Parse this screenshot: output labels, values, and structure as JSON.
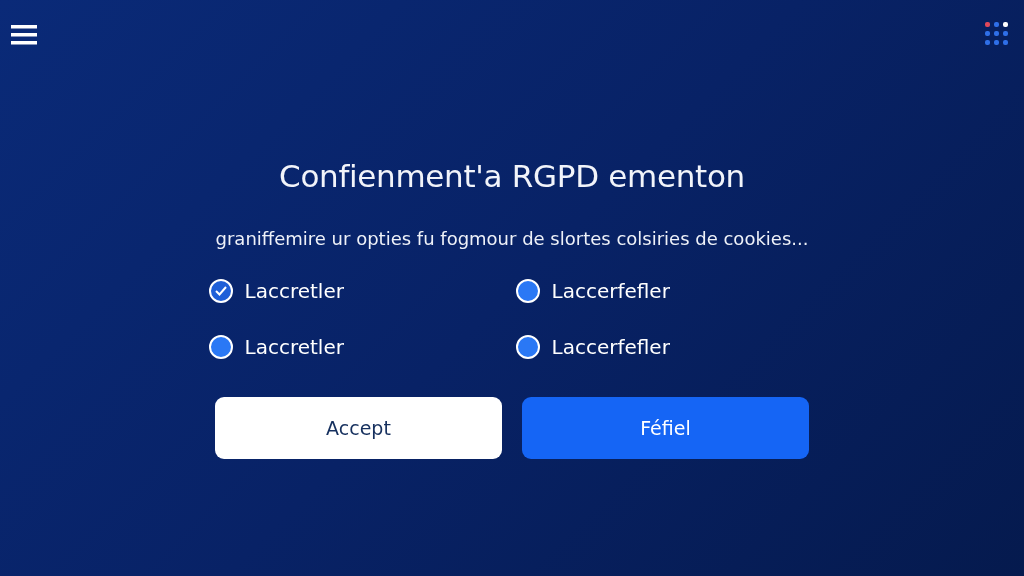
{
  "title": "Confienment'a RGPD ementon",
  "subtitle": "graniffemire ur opties fu fogmour de slortes colsiries de cookies...",
  "options": [
    {
      "label": "Laccretler",
      "checked": true
    },
    {
      "label": "Laccerfefler",
      "checked": false
    },
    {
      "label": "Laccretler",
      "checked": false
    },
    {
      "label": "Laccerfefler",
      "checked": false
    }
  ],
  "buttons": [
    {
      "label": "Accept",
      "kind": "secondary"
    },
    {
      "label": "Féfiel",
      "kind": "primary"
    }
  ]
}
